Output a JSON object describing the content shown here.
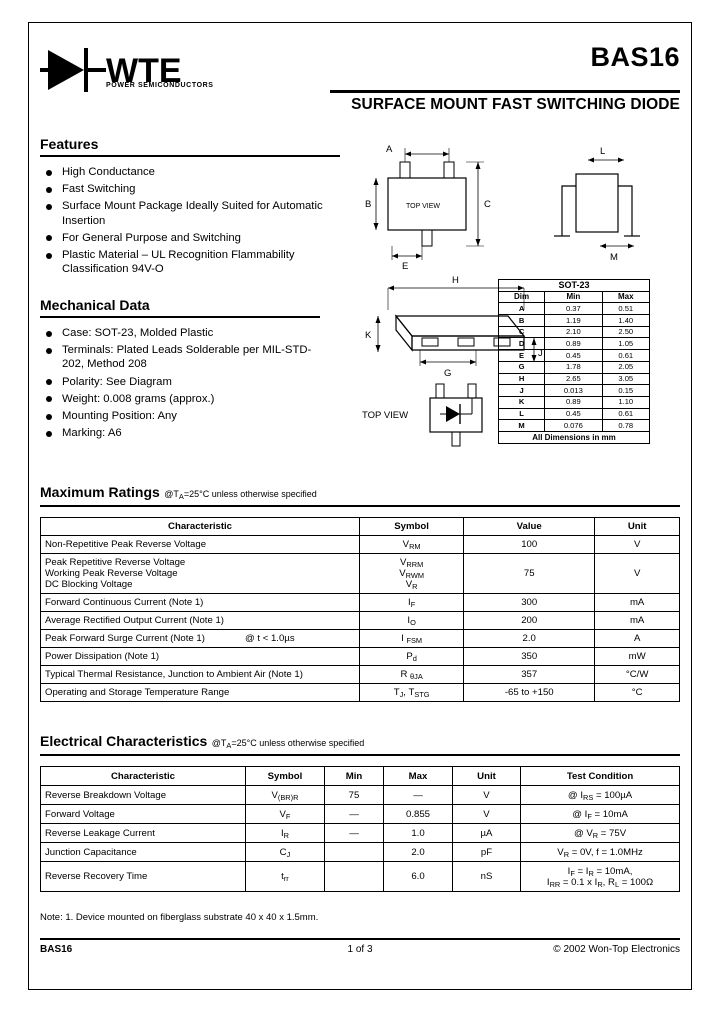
{
  "header": {
    "brand": "WTE",
    "brand_sub": "POWER SEMICONDUCTORS",
    "part_number": "BAS16",
    "subtitle": "SURFACE MOUNT FAST SWITCHING DIODE"
  },
  "features": {
    "title": "Features",
    "items": [
      "High Conductance",
      "Fast Switching",
      "Surface Mount Package Ideally Suited for Automatic Insertion",
      "For General Purpose and Switching",
      "Plastic Material – UL Recognition Flammability Classification 94V-O"
    ]
  },
  "mechanical": {
    "title": "Mechanical Data",
    "items": [
      "Case: SOT-23, Molded Plastic",
      "Terminals: Plated Leads Solderable per MIL-STD-202, Method 208",
      "Polarity: See Diagram",
      "Weight: 0.008 grams (approx.)",
      "Mounting Position: Any",
      "Marking: A6"
    ]
  },
  "drawing": {
    "top_view_label": "TOP VIEW",
    "top_view_label_2": "TOP VIEW",
    "dims": [
      "A",
      "B",
      "C",
      "E",
      "G",
      "H",
      "J",
      "K",
      "L",
      "M"
    ]
  },
  "dim_table": {
    "package": "SOT-23",
    "headers": [
      "Dim",
      "Min",
      "Max"
    ],
    "rows": [
      [
        "A",
        "0.37",
        "0.51"
      ],
      [
        "B",
        "1.19",
        "1.40"
      ],
      [
        "C",
        "2.10",
        "2.50"
      ],
      [
        "D",
        "0.89",
        "1.05"
      ],
      [
        "E",
        "0.45",
        "0.61"
      ],
      [
        "G",
        "1.78",
        "2.05"
      ],
      [
        "H",
        "2.65",
        "3.05"
      ],
      [
        "J",
        "0.013",
        "0.15"
      ],
      [
        "K",
        "0.89",
        "1.10"
      ],
      [
        "L",
        "0.45",
        "0.61"
      ],
      [
        "M",
        "0.076",
        "0.78"
      ]
    ],
    "footer": "All Dimensions in mm"
  },
  "max_ratings": {
    "title": "Maximum Ratings",
    "condition": "@TA=25°C unless otherwise specified",
    "headers": [
      "Characteristic",
      "Symbol",
      "Value",
      "Unit"
    ],
    "rows": [
      {
        "characteristic": "Non-Repetitive Peak Reverse Voltage",
        "symbol": "VRM",
        "value": "100",
        "unit": "V"
      },
      {
        "characteristic": "Peak Repetitive Reverse Voltage\nWorking Peak Reverse Voltage\nDC Blocking Voltage",
        "symbol": "VRRM\nVRWM\nVR",
        "value": "75",
        "unit": "V"
      },
      {
        "characteristic": "Forward Continuous Current (Note 1)",
        "symbol": "IF",
        "value": "300",
        "unit": "mA"
      },
      {
        "characteristic": "Average Rectified Output Current (Note 1)",
        "symbol": "IO",
        "value": "200",
        "unit": "mA"
      },
      {
        "characteristic": "Peak Forward Surge Current (Note 1)",
        "condition": "@ t < 1.0µs",
        "symbol": "I FSM",
        "value": "2.0",
        "unit": "A"
      },
      {
        "characteristic": "Power Dissipation (Note 1)",
        "symbol": "Pd",
        "value": "350",
        "unit": "mW"
      },
      {
        "characteristic": "Typical Thermal Resistance, Junction to Ambient Air (Note 1)",
        "symbol": "R θJA",
        "value": "357",
        "unit": "°C/W"
      },
      {
        "characteristic": "Operating and Storage Temperature Range",
        "symbol": "TJ, TSTG",
        "value": "-65 to +150",
        "unit": "°C"
      }
    ]
  },
  "electrical": {
    "title": "Electrical Characteristics",
    "condition": "@TA=25°C unless otherwise specified",
    "headers": [
      "Characteristic",
      "Symbol",
      "Min",
      "Max",
      "Unit",
      "Test Condition"
    ],
    "rows": [
      {
        "characteristic": "Reverse Breakdown Voltage",
        "symbol": "V(BR)R",
        "min": "75",
        "max": "—",
        "unit": "V",
        "test": "@ IRS = 100µA"
      },
      {
        "characteristic": "Forward Voltage",
        "symbol": "VF",
        "min": "—",
        "max": "0.855",
        "unit": "V",
        "test": "@ IF = 10mA"
      },
      {
        "characteristic": "Reverse Leakage Current",
        "symbol": "IR",
        "min": "—",
        "max": "1.0",
        "unit": "µA",
        "test": "@ VR = 75V"
      },
      {
        "characteristic": "Junction Capacitance",
        "symbol": "CJ",
        "min": "",
        "max": "2.0",
        "unit": "pF",
        "test": "VR = 0V, f = 1.0MHz"
      },
      {
        "characteristic": "Reverse Recovery Time",
        "symbol": "trr",
        "min": "",
        "max": "6.0",
        "unit": "nS",
        "test": "IF = IR = 10mA,\nIRR = 0.1 x IR, RL = 100Ω"
      }
    ]
  },
  "note": "Note:  1. Device mounted on fiberglass substrate 40 x 40 x 1.5mm.",
  "footer": {
    "left": "BAS16",
    "center": "1 of 3",
    "right": "© 2002 Won-Top Electronics"
  }
}
